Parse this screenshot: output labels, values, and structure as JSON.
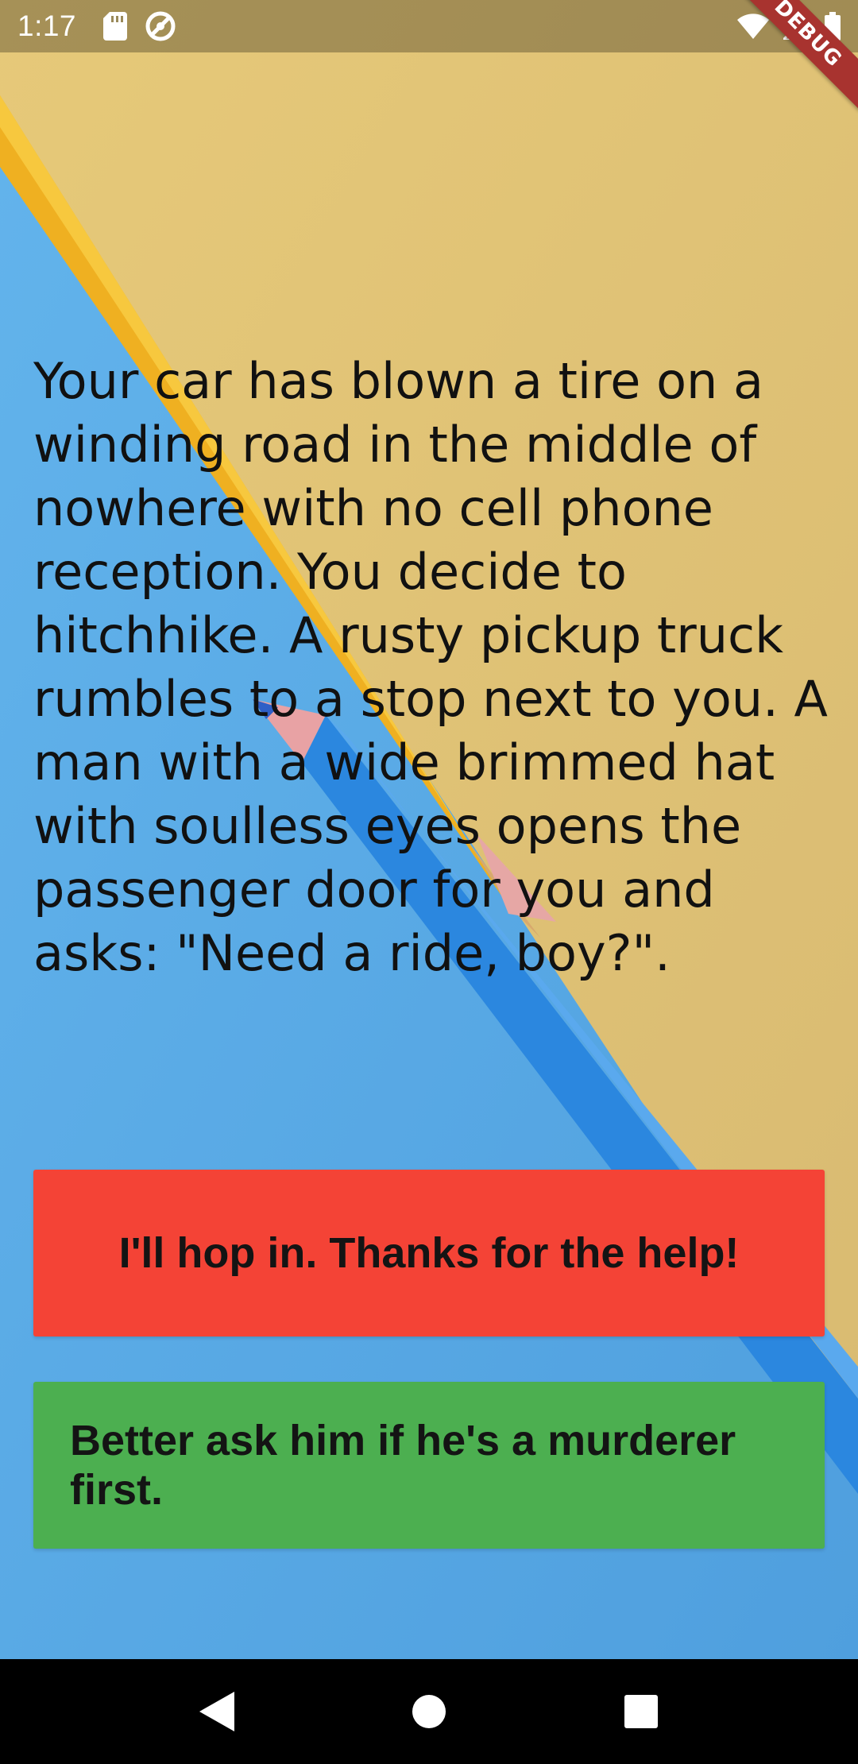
{
  "status_bar": {
    "time": "1:17",
    "left_icons": [
      "sd-card-icon",
      "sync-disabled-icon"
    ],
    "right_icons": [
      "wifi-icon",
      "cell-signal-icon",
      "battery-icon"
    ],
    "debug_banner": "DEBUG"
  },
  "story": {
    "text": "Your car has blown a tire on a winding road in the middle of nowhere with no cell phone reception. You decide to hitchhike. A rusty pickup truck rumbles to a stop next to you. A man with a wide brimmed hat with soulless eyes opens the passenger door for you and asks: \"Need a ride, boy?\"."
  },
  "choices": [
    {
      "label": "I'll hop in. Thanks for the help!",
      "color": "#f44336"
    },
    {
      "label": "Better ask him if he's a murderer first.",
      "color": "#4caf50"
    }
  ],
  "nav_bar": {
    "buttons": [
      "back-icon",
      "home-icon",
      "recents-icon"
    ]
  },
  "colors": {
    "paper_blue": "#58a8e4",
    "paper_yellow": "#e2c47c",
    "pencil_yellow": "#f2b522",
    "pencil_blue": "#2a86e0"
  }
}
